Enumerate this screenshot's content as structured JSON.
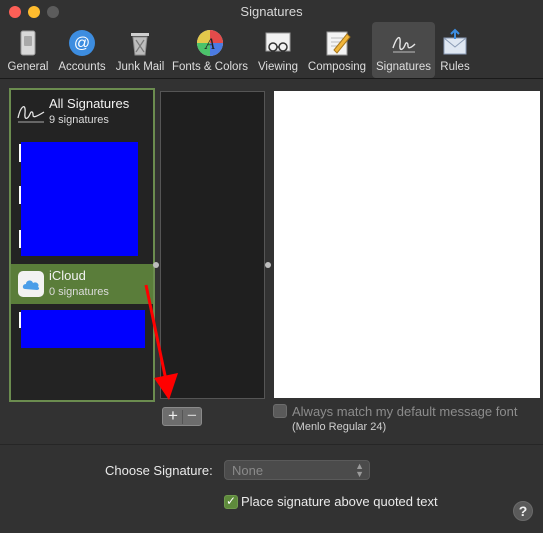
{
  "window": {
    "title": "Signatures"
  },
  "toolbar": {
    "tabs": [
      {
        "label": "General",
        "icon": "switch-icon"
      },
      {
        "label": "Accounts",
        "icon": "at-sign-icon"
      },
      {
        "label": "Junk Mail",
        "icon": "trash-can-icon"
      },
      {
        "label": "Fonts & Colors",
        "icon": "color-wheel-font-icon"
      },
      {
        "label": "Viewing",
        "icon": "glasses-icon"
      },
      {
        "label": "Composing",
        "icon": "pencil-paper-icon"
      },
      {
        "label": "Signatures",
        "icon": "signature-icon",
        "selected": true
      },
      {
        "label": "Rules",
        "icon": "envelope-rules-icon"
      }
    ]
  },
  "signatures_list": {
    "all": {
      "name": "All Signatures",
      "count_label": "9 signatures"
    },
    "icloud": {
      "name": "iCloud",
      "count_label": "0 signatures",
      "selected": true
    }
  },
  "buttons": {
    "add": "+",
    "remove": "−"
  },
  "options": {
    "always_match": {
      "label": "Always match my default message font",
      "checked": false,
      "enabled": false
    },
    "font_note": "(Menlo Regular 24)",
    "choose_signature": {
      "label": "Choose Signature:",
      "value": "None"
    },
    "place_above": {
      "label": "Place signature above quoted text",
      "checked": true
    }
  },
  "help": "?",
  "colors": {
    "accent_green": "#5e8a3c",
    "selection_green": "#5a7d3a",
    "redaction": "#0000ff",
    "annotation_arrow": "#ff0000"
  }
}
